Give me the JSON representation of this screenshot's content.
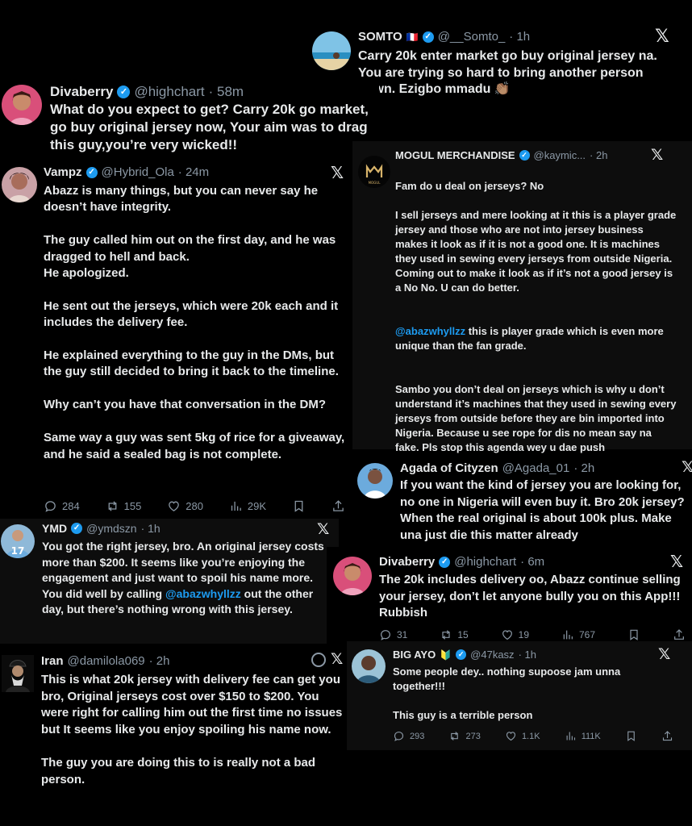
{
  "colors": {
    "background": "#000000",
    "text": "#e7e9ea",
    "muted": "#8b98a5",
    "link": "#1d9bf0",
    "verified": "#1d9bf0"
  },
  "tweets": {
    "somto": {
      "name": "SOMTO",
      "flag": "🇫🇷",
      "handle": "@__Somto_",
      "time": "· 1h",
      "text": "Carry 20k enter market go buy original jersey na. You are trying so hard to bring another person down. Ezigbo mmadu 👏🏽"
    },
    "divaberry1": {
      "name": "Divaberry",
      "handle": "@highchart",
      "time": "· 58m",
      "text": "What do you expect to get? Carry 20k go market, go buy original jersey now, Your aim was to drag this guy,you’re very wicked!!"
    },
    "vampz": {
      "name": "Vampz",
      "handle": "@Hybrid_Ola",
      "time": "· 24m",
      "text": "Abazz is many things, but you can never say he doesn’t have integrity.\n\nThe guy called him out on the first day, and he was dragged to hell and back.\nHe apologized.\n\nHe sent out the jerseys, which were 20k each and it includes the delivery fee.\n\nHe explained everything to the guy in the DMs, but the guy still decided to bring it back to the timeline.\n\nWhy can’t you have that conversation in the DM?\n\nSame way a guy was sent 5kg of rice for a giveaway, and he said a sealed bag is not complete.",
      "replies": "284",
      "reposts": "155",
      "likes": "280",
      "views": "29K"
    },
    "mogul": {
      "name": "MOGUL MERCHANDISE",
      "handle": "@kaymic...",
      "time": "· 2h",
      "text_1": "Fam do u deal on jerseys? No\n\nI sell jerseys and mere looking at it this is a player grade jersey and those who are not into jersey business makes it look as if it is not a good one. It is machines they used in sewing every jerseys from outside Nigeria. Coming out to make it look as if it’s not a good jersey is a No No. U can do better.",
      "mention": "@abazwhyllzz",
      "text_2": " this is player grade which is even more unique than the fan grade.",
      "text_3": "Sambo you don’t deal on jerseys which is why u don’t understand it’s machines that they used in sewing every jerseys from outside before they are bin imported into Nigeria. Because u see rope for dis no mean say na fake. Pls stop this agenda wey u dae push"
    },
    "agada": {
      "name": "Agada of Cityzen",
      "handle": "@Agada_01",
      "time": "· 2h",
      "text": "If you want the kind of jersey you are looking for, no one in Nigeria will even buy it. Bro 20k jersey? When the real original is about 100k plus. Make una just die this matter already"
    },
    "ymd": {
      "name": "YMD",
      "handle": "@ymdszn",
      "time": "· 1h",
      "text_1": "You got the right jersey, bro. An original jersey costs more than $200. It seems like you’re enjoying the engagement and just want to spoil his name more. You did well by calling ",
      "mention": "@abazwhyllzz",
      "text_2": " out the other day, but there’s nothing wrong with this jersey."
    },
    "divaberry2": {
      "name": "Divaberry",
      "handle": "@highchart",
      "time": "· 6m",
      "text": "The 20k includes delivery oo, Abazz continue selling your jersey, don’t let anyone bully you on this App!!! Rubbish",
      "replies": "31",
      "reposts": "15",
      "likes": "19",
      "views": "767"
    },
    "iran": {
      "name": "Iran",
      "handle": "@damilola069",
      "time": "· 2h",
      "text": "This is what 20k jersey with delivery fee can get you bro, Original jerseys cost over $150 to $200. You were right for calling him out the first time no issues but It seems like you enjoy spoiling his name now.\n\nThe guy you are doing this to is really not a bad person."
    },
    "bigayo": {
      "name": "BIG AYO",
      "flag": "🔰",
      "handle": "@47kasz",
      "time": "· 1h",
      "text": "Some people dey.. nothing supoose jam unna together!!!\n\nThis guy is a terrible person",
      "replies": "293",
      "reposts": "273",
      "likes": "1.1K",
      "views": "111K"
    }
  },
  "icons": [
    "x-logo-icon",
    "verified-badge-icon",
    "reply-icon",
    "repost-icon",
    "like-icon",
    "views-icon",
    "bookmark-icon",
    "share-icon",
    "grok-icon"
  ]
}
